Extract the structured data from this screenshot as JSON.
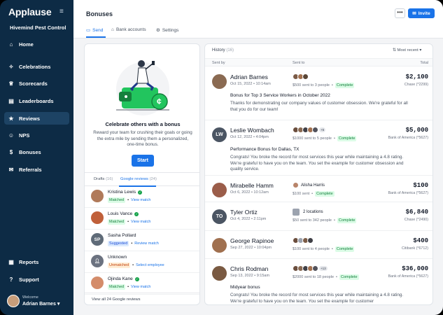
{
  "sidebar": {
    "logo": "Applause",
    "org": "Hivemind Pest Control",
    "items": [
      {
        "label": "Home",
        "icon": "home-icon"
      },
      {
        "label": "Celebrations",
        "icon": "party-icon"
      },
      {
        "label": "Scorecards",
        "icon": "trophy-icon"
      },
      {
        "label": "Leaderboards",
        "icon": "leaderboard-icon"
      },
      {
        "label": "Reviews",
        "icon": "star-icon"
      },
      {
        "label": "NPS",
        "icon": "nps-icon"
      },
      {
        "label": "Bonuses",
        "icon": "dollar-icon"
      },
      {
        "label": "Referrals",
        "icon": "megaphone-icon"
      },
      {
        "label": "Reports",
        "icon": "report-icon"
      },
      {
        "label": "Support",
        "icon": "help-icon"
      }
    ],
    "welcome_label": "Welcome",
    "user_name": "Adrian Barnes"
  },
  "header": {
    "title": "Bonuses",
    "more_label": "•••",
    "invite_label": "Invite",
    "tabs": [
      {
        "label": "Send",
        "icon": "send-icon"
      },
      {
        "label": "Bank accounts",
        "icon": "bank-icon"
      },
      {
        "label": "Settings",
        "icon": "gear-icon"
      }
    ]
  },
  "promo": {
    "title": "Celebrate others with a bonus",
    "description": "Reward your team for crushing their goals or going the extra mile by sending them a personalized, one-time bonus.",
    "start_label": "Start"
  },
  "review_tabs": {
    "drafts": "Drafts",
    "drafts_count": "(16)",
    "google": "Google reviews",
    "google_count": "(24)"
  },
  "reviews": [
    {
      "name": "Kristina Lewis",
      "status": "Matched",
      "link": "View match",
      "avatar": "#b07a5a",
      "initials": ""
    },
    {
      "name": "Louis Vance",
      "status": "Matched",
      "link": "View match",
      "avatar": "#c0603a",
      "initials": ""
    },
    {
      "name": "Sasha Pollard",
      "status": "Suggested",
      "link": "Review match",
      "avatar": "#5f6b78",
      "initials": "SP"
    },
    {
      "name": "Unknown",
      "status": "Unmatched",
      "link": "Select employee",
      "avatar": "#6b7280",
      "initials": ""
    },
    {
      "name": "Ojinda Kane",
      "status": "Matched",
      "link": "View match",
      "avatar": "#d48c6a",
      "initials": ""
    }
  ],
  "view_all_label": "View all 24 Google reviews",
  "history": {
    "title": "History",
    "count": "(16)",
    "sort_label": "Most recent",
    "col_sent_by": "Sent by",
    "col_sent_to": "Sent to",
    "col_total": "Total"
  },
  "bonuses": [
    {
      "name": "Adrian Barnes",
      "date": "Oct 15, 2022 • 10:14am",
      "sent_desc": "$500 sent to 3 people",
      "status": "Complete",
      "amount": "$2,100",
      "account": "Chase (*2299)",
      "title": "Bonus for Top 3 Service Workers in October 2022",
      "message": "Thanks for demonstrating our company values of customer obsession. We're grateful for all that you do for our team!",
      "initials": "",
      "avatar": "#8a6a52",
      "recipient_count": "",
      "recipient_name": ""
    },
    {
      "name": "Leslie Wombach",
      "date": "Oct 12, 2022 • 4:04pm",
      "sent_desc": "$1000 sent to 5 people",
      "status": "Complete",
      "amount": "$5,000",
      "account": "Bank of America (*5627)",
      "title": "Performance Bonus for Dallas, TX",
      "message": "Congrats! You broke the record for most services this year while maintaining a 4.8 rating. We're grateful to have you on the team. You set the example for customer obsession and quality service.",
      "initials": "LW",
      "avatar": "#4b5563",
      "recipient_count": "+5",
      "recipient_name": ""
    },
    {
      "name": "Mirabelle Hamm",
      "date": "Oct 6, 2022 • 10:12am",
      "sent_desc": "$100 sent",
      "status": "Complete",
      "amount": "$100",
      "account": "Bank of America (*5627)",
      "title": "",
      "message": "",
      "initials": "",
      "avatar": "#9b5d4a",
      "recipient_count": "",
      "recipient_name": "Alisha Harris"
    },
    {
      "name": "Tyler Ortiz",
      "date": "Oct 4, 2022 • 2:11pm",
      "sent_desc": "$50 sent to 342 people",
      "status": "Complete",
      "amount": "$6,840",
      "account": "Chase (*2490)",
      "title": "",
      "message": "",
      "initials": "TO",
      "avatar": "#4b5563",
      "recipient_count": "",
      "recipient_name": "2 locations"
    },
    {
      "name": "George Rapinoe",
      "date": "Sep 27, 2022 • 10:04pm",
      "sent_desc": "$100 sent to 4 people",
      "status": "Complete",
      "amount": "$400",
      "account": "Citibank (*6712)",
      "title": "",
      "message": "",
      "initials": "",
      "avatar": "#a0704f",
      "recipient_count": "",
      "recipient_name": ""
    },
    {
      "name": "Chris Rodman",
      "date": "Sep 13, 2022 • 9:15am",
      "sent_desc": "$2000 sent to 18 people",
      "status": "Complete",
      "amount": "$36,000",
      "account": "Bank of America (*5627)",
      "title": "Midyear bonus",
      "message": "Congrats! You broke the record for most services this year while maintaining a 4.8 rating. We're grateful to have you on the team. You set the example for customer",
      "initials": "",
      "avatar": "#7a5a42",
      "recipient_count": "+13",
      "recipient_name": ""
    }
  ]
}
